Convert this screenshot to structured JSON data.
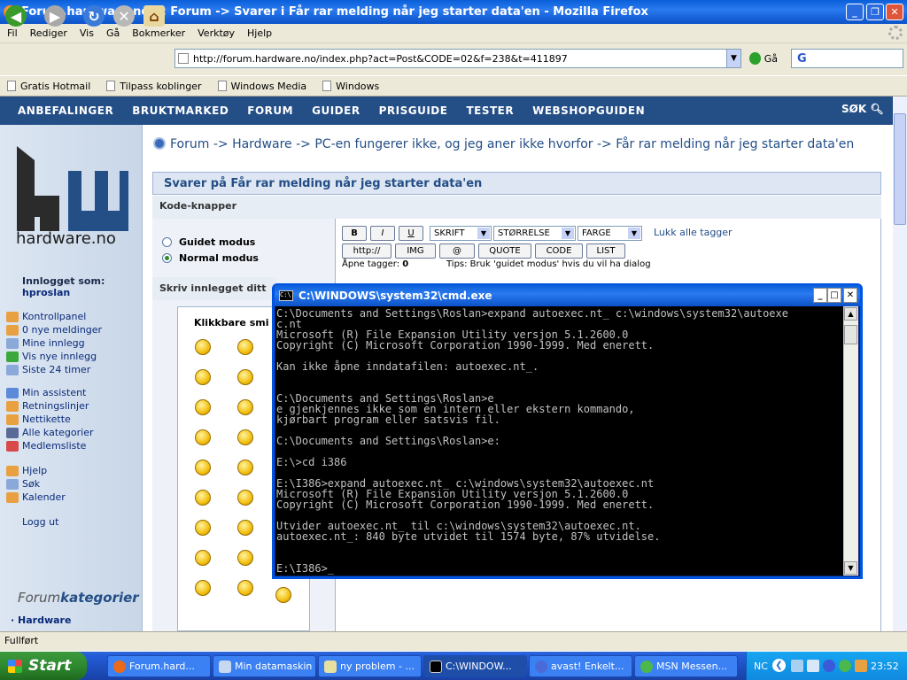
{
  "firefox": {
    "title": "Forum.hardware.no : : Forum -> Svarer i Får rar melding når jeg starter data'en - Mozilla Firefox",
    "menu": [
      "Fil",
      "Rediger",
      "Vis",
      "Gå",
      "Bokmerker",
      "Verktøy",
      "Hjelp"
    ],
    "url": "http://forum.hardware.no/index.php?act=Post&CODE=02&f=238&t=411897",
    "go_label": "Gå",
    "search_glyph": "G",
    "bookmarks": [
      "Gratis Hotmail",
      "Tilpass koblinger",
      "Windows Media",
      "Windows"
    ],
    "status": "Fullført"
  },
  "site": {
    "nav": [
      "ANBEFALINGER",
      "BRUKTMARKED",
      "FORUM",
      "GUIDER",
      "PRISGUIDE",
      "TESTER",
      "WEBSHOPGUIDEN"
    ],
    "search_label": "SØK",
    "logo_text": "hardware.no",
    "logged_in_label": "Innlogget som:",
    "username": "hproslan",
    "links_group1": [
      "Kontrollpanel",
      "0 nye meldinger",
      "Mine innlegg",
      "Vis nye innlegg",
      "Siste 24 timer"
    ],
    "links_group2": [
      "Min assistent",
      "Retningslinjer",
      "Nettikette",
      "Alle kategorier",
      "Medlemsliste"
    ],
    "links_group3": [
      "Hjelp",
      "Søk",
      "Kalender"
    ],
    "logout": "Logg ut",
    "forum_cat_prefix": "Forum",
    "forum_cat_suffix": "kategorier",
    "forum_cat_first": "Hardware"
  },
  "main": {
    "breadcrumb": "Forum -> Hardware -> PC-en fungerer ikke, og jeg aner ikke hvorfor -> Får rar melding når jeg starter data'en",
    "reply_title": "Svarer på Får rar melding når jeg starter data'en",
    "code_buttons_label": "Kode-knapper",
    "mode_guided": "Guidet modus",
    "mode_normal": "Normal modus",
    "fmt": {
      "bold": "B",
      "italic": "I",
      "underline": "U",
      "font": "SKRIFT",
      "size": "STØRRELSE",
      "color": "FARGE",
      "close_tags": "Lukk alle tagger",
      "http": "http://",
      "img": "IMG",
      "email": "@",
      "quote": "QUOTE",
      "code": "CODE",
      "list": "LIST",
      "open_tags_label": "Åpne tagger:",
      "open_tags_count": "0",
      "tip": "Tips: Bruk 'guidet modus' hvis du vil ha dialog"
    },
    "write_label": "Skriv innlegget ditt",
    "smileys_label": "Klikkbare smi"
  },
  "cmd": {
    "title": "C:\\WINDOWS\\system32\\cmd.exe",
    "output": "C:\\Documents and Settings\\Roslan>expand autoexec.nt_ c:\\windows\\system32\\autoexe\nc.nt\nMicrosoft (R) File Expansion Utility versjon 5.1.2600.0\nCopyright (C) Microsoft Corporation 1990-1999. Med enerett.\n\nKan ikke åpne inndatafilen: autoexec.nt_.\n\n\nC:\\Documents and Settings\\Roslan>e\ne gjenkjennes ikke som en intern eller ekstern kommando,\nkjørbart program eller satsvis fil.\n\nC:\\Documents and Settings\\Roslan>e:\n\nE:\\>cd i386\n\nE:\\I386>expand autoexec.nt_ c:\\windows\\system32\\autoexec.nt\nMicrosoft (R) File Expansion Utility versjon 5.1.2600.0\nCopyright (C) Microsoft Corporation 1990-1999. Med enerett.\n\nUtvider autoexec.nt_ til c:\\windows\\system32\\autoexec.nt.\nautoexec.nt_: 840 byte utvidet til 1574 byte, 87% utvidelse.\n\n\nE:\\I386>_"
  },
  "taskbar": {
    "start": "Start",
    "tasks": [
      "Forum.hard...",
      "Min datamaskin",
      "ny problem - ...",
      "C:\\WINDOW...",
      "avast! Enkelt...",
      "MSN Messen..."
    ],
    "tray_lang": "NC",
    "clock": "23:52"
  },
  "colors": {
    "site_nav": "#234e86",
    "xp_blue": "#0a5fd8",
    "start_green": "#2f8a2f"
  }
}
